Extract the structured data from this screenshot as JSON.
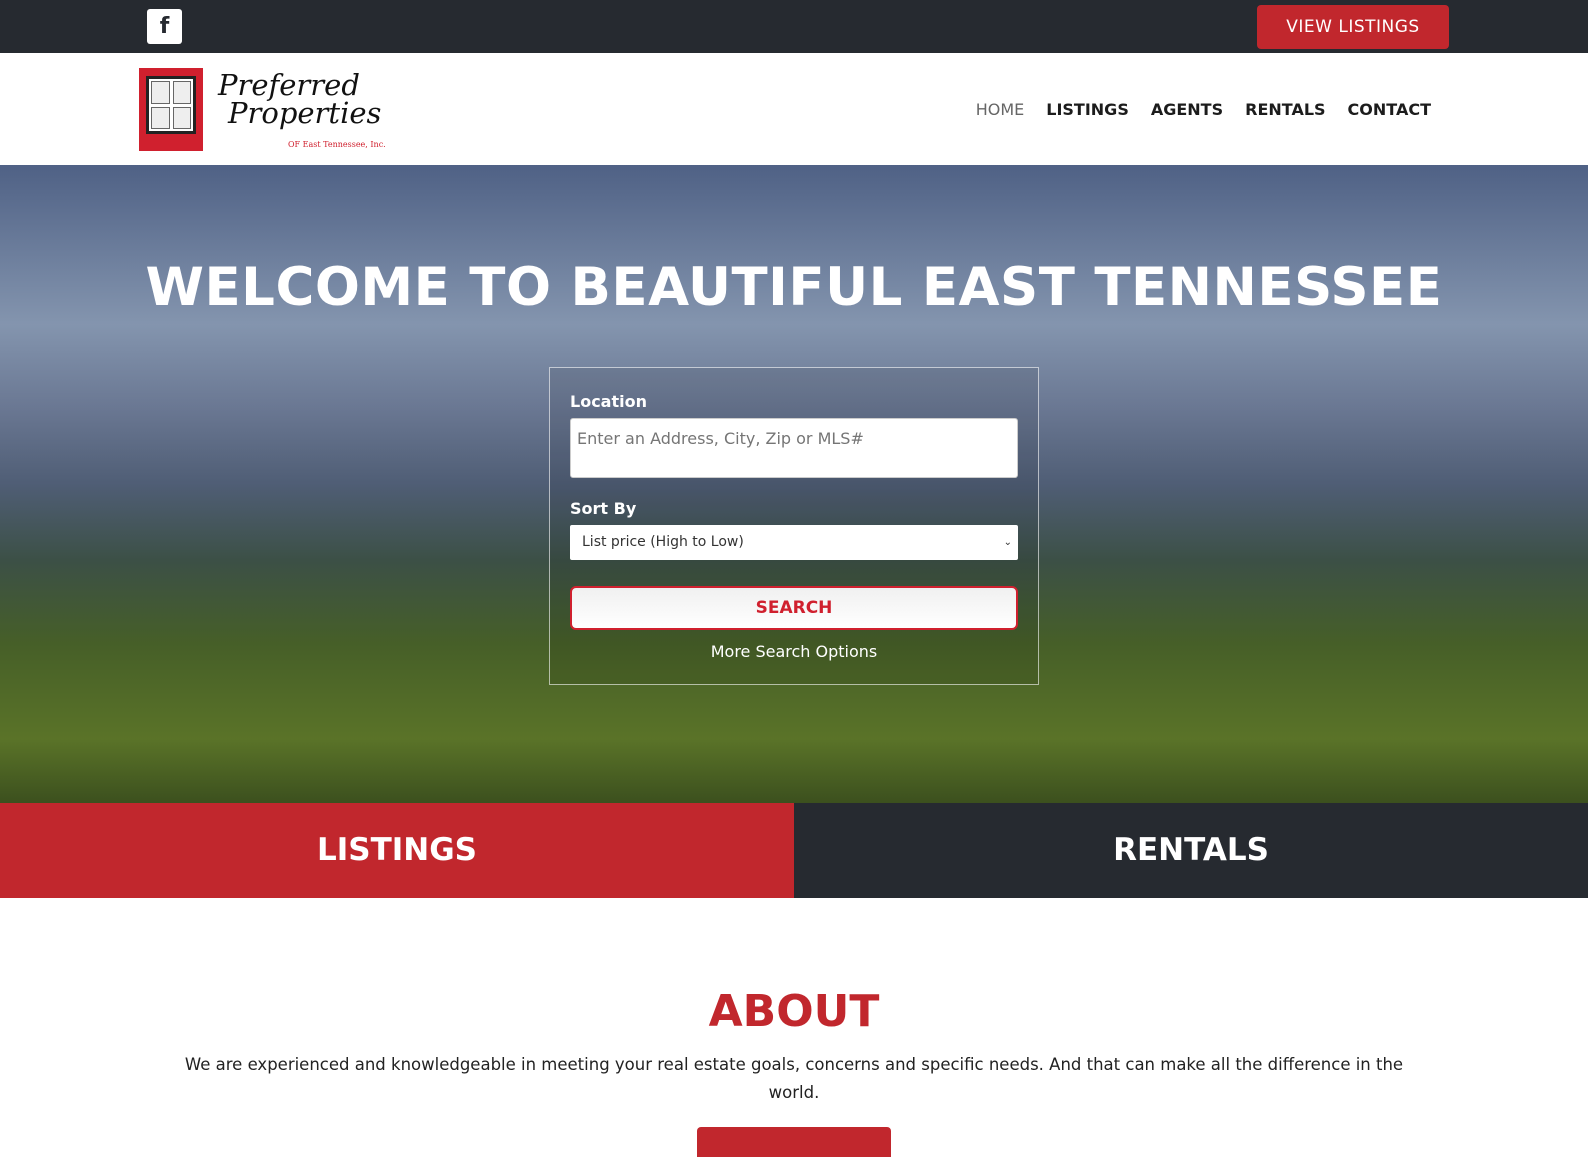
{
  "topbar": {
    "facebook_icon": "facebook-icon",
    "view_listings": "VIEW LISTINGS"
  },
  "logo": {
    "line1": "Preferred",
    "line2": "Properties",
    "line3": "OF East Tennessee, Inc."
  },
  "nav": [
    {
      "label": "HOME"
    },
    {
      "label": "LISTINGS"
    },
    {
      "label": "AGENTS"
    },
    {
      "label": "RENTALS"
    },
    {
      "label": "CONTACT"
    }
  ],
  "hero": {
    "title": "WELCOME TO BEAUTIFUL EAST TENNESSEE",
    "search": {
      "location_label": "Location",
      "location_placeholder": "Enter an Address, City, Zip or MLS#",
      "sort_label": "Sort By",
      "sort_value": "List price (High to Low)",
      "search_button": "SEARCH",
      "more_options": "More Search Options"
    }
  },
  "tiles": {
    "listings": "LISTINGS",
    "rentals": "RENTALS"
  },
  "about": {
    "title": "ABOUT",
    "text": "We are experienced and knowledgeable in meeting your real estate goals, concerns and specific needs. And that can make all the difference in the world."
  },
  "colors": {
    "accent": "#c1272d",
    "dark": "#262a30"
  }
}
